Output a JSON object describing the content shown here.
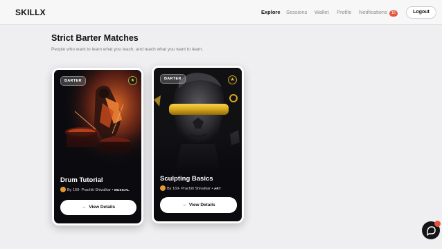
{
  "nav": {
    "logo": "SKILLX",
    "links": [
      "Explore",
      "Sessions",
      "Wallet",
      "Profile",
      "Notifications"
    ],
    "notifications_count": "15",
    "logout_label": "Logout"
  },
  "main": {
    "title": "Strict Barter Matches",
    "subtitle": "People who want to learn what you teach, and teach what you want to learn."
  },
  "cards": [
    {
      "badge": "BARTER",
      "title": "Drum Tutorial",
      "by": "By 169- Prachiti Shivalkar •",
      "category": "MUSICAL",
      "button": "View Details"
    },
    {
      "badge": "BARTER",
      "title": "Sculpting Basics",
      "by": "By 169- Prachiti Shivalkar •",
      "category": "ART",
      "button": "View Details"
    }
  ],
  "icons": {
    "star": "star-icon",
    "arrow": "arrow-right-icon",
    "chat": "chat-icon"
  },
  "colors": {
    "accent": "#e5533d",
    "gold": "#c9a227",
    "card_bg": "#0b0b0f"
  }
}
